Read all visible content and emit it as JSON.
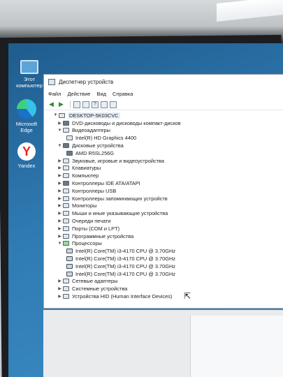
{
  "desktop_icons": [
    {
      "label_line1": "Этот",
      "label_line2": "компьютер"
    },
    {
      "label_line1": "Microsoft",
      "label_line2": "Edge"
    },
    {
      "label_line1": "Yandex",
      "label_line2": ""
    }
  ],
  "window": {
    "title": "Диспетчер устройств",
    "menu": [
      "Файл",
      "Действие",
      "Вид",
      "Справка"
    ]
  },
  "tree": {
    "root": "DESKTOP-5K03CVC",
    "nodes": [
      {
        "label": "DVD-дисководы и дисководы компакт-дисков",
        "expanded": false
      },
      {
        "label": "Видеоадаптеры",
        "expanded": true,
        "children": [
          "Intel(R) HD Graphics 4400"
        ]
      },
      {
        "label": "Дисковые устройства",
        "expanded": true,
        "children": [
          "AMD R5SL256G"
        ]
      },
      {
        "label": "Звуковые, игровые и видеоустройства",
        "expanded": false
      },
      {
        "label": "Клавиатуры",
        "expanded": false
      },
      {
        "label": "Компьютер",
        "expanded": false
      },
      {
        "label": "Контроллеры IDE ATA/ATAPI",
        "expanded": false
      },
      {
        "label": "Контроллеры USB",
        "expanded": false
      },
      {
        "label": "Контроллеры запоминающих устройств",
        "expanded": false
      },
      {
        "label": "Мониторы",
        "expanded": false
      },
      {
        "label": "Мыши и иные указывающие устройства",
        "expanded": false
      },
      {
        "label": "Очереди печати",
        "expanded": false
      },
      {
        "label": "Порты (COM и LPT)",
        "expanded": false
      },
      {
        "label": "Программные устройства",
        "expanded": false
      },
      {
        "label": "Процессоры",
        "expanded": true,
        "children": [
          "Intel(R) Core(TM) i3-4170 CPU @ 3.70GHz",
          "Intel(R) Core(TM) i3-4170 CPU @ 3.70GHz",
          "Intel(R) Core(TM) i3-4170 CPU @ 3.70GHz",
          "Intel(R) Core(TM) i3-4170 CPU @ 3.70GHz"
        ]
      },
      {
        "label": "Сетевые адаптеры",
        "expanded": false
      },
      {
        "label": "Системные устройства",
        "expanded": false
      },
      {
        "label": "Устройства HID (Human Interface Devices)",
        "expanded": false
      }
    ]
  },
  "icons": {
    "expanded": "chevron-down-icon",
    "collapsed": "chevron-right-icon",
    "back": "arrow-left-icon",
    "forward": "arrow-right-icon"
  }
}
